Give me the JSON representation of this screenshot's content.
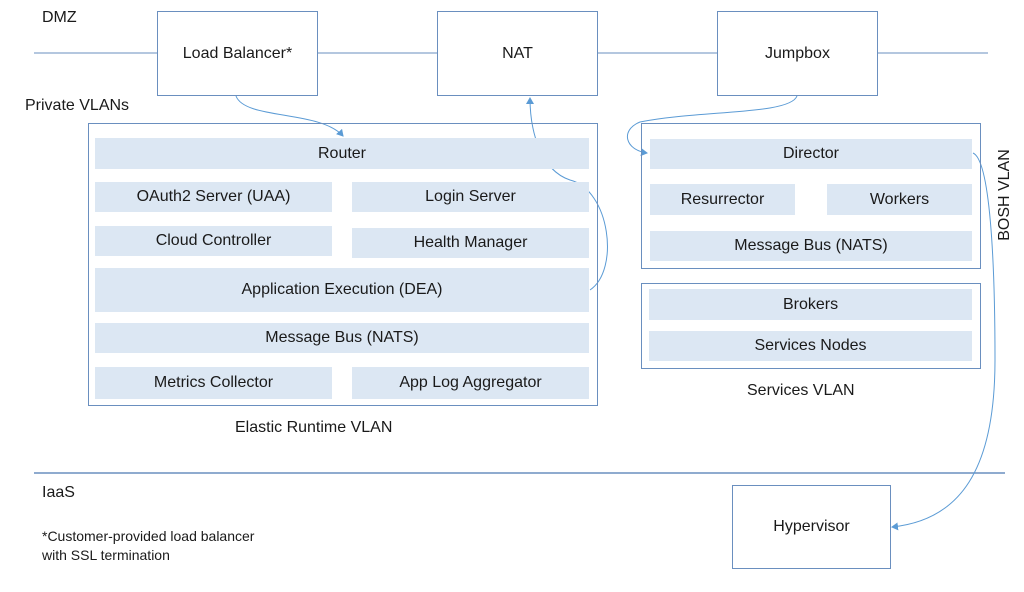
{
  "zones": {
    "dmz": "DMZ",
    "private_vlans": "Private VLANs",
    "iaas": "IaaS"
  },
  "dmz_nodes": {
    "load_balancer": "Load Balancer*",
    "nat": "NAT",
    "jumpbox": "Jumpbox"
  },
  "elastic_runtime": {
    "label": "Elastic Runtime VLAN",
    "router": "Router",
    "oauth2": "OAuth2 Server (UAA)",
    "login": "Login Server",
    "cloud_controller": "Cloud Controller",
    "health_manager": "Health Manager",
    "dea": "Application Execution (DEA)",
    "message_bus": "Message Bus (NATS)",
    "metrics": "Metrics Collector",
    "app_log": "App Log Aggregator"
  },
  "bosh": {
    "label": "BOSH VLAN",
    "director": "Director",
    "resurrector": "Resurrector",
    "workers": "Workers",
    "message_bus": "Message Bus (NATS)"
  },
  "services": {
    "label": "Services VLAN",
    "brokers": "Brokers",
    "nodes": "Services Nodes"
  },
  "iaas_nodes": {
    "hypervisor": "Hypervisor"
  },
  "footnote": {
    "line1": "*Customer-provided load balancer",
    "line2": "with SSL termination"
  },
  "colors": {
    "line": "#6a8fbf",
    "arrow": "#5b9bd5",
    "component_fill": "#dce7f3"
  }
}
